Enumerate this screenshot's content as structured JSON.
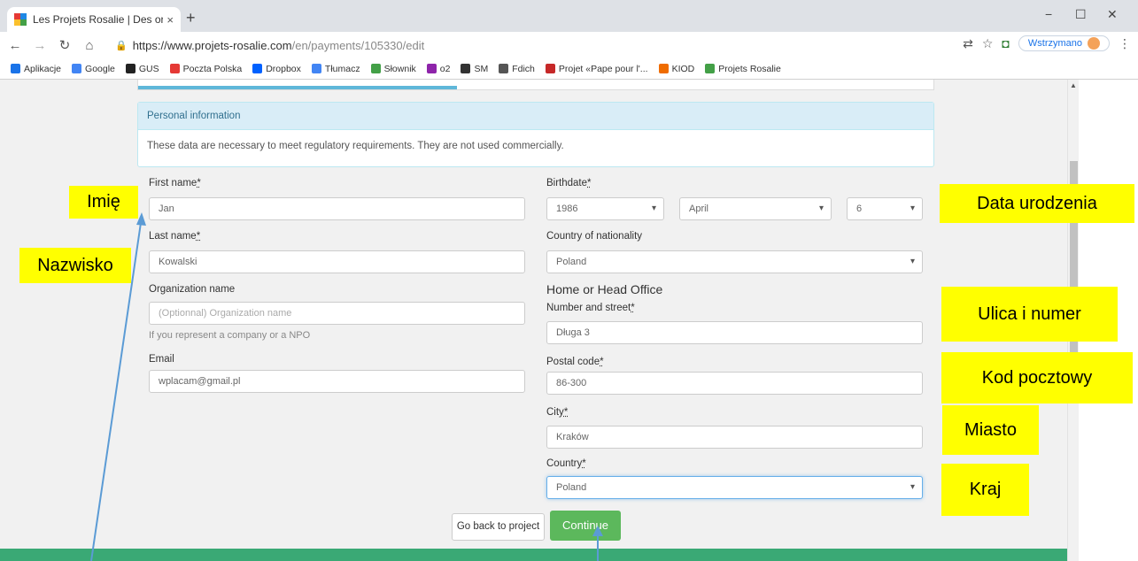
{
  "browser": {
    "tab_title": "Les Projets Rosalie | Des ordinate",
    "tab_close": "×",
    "new_tab": "+",
    "url_host": "https://www.projets-rosalie.com",
    "url_path": "/en/payments/105330/edit",
    "paused_label": "Wstrzymano",
    "window_controls": [
      "−",
      "☐",
      "✕"
    ],
    "bookmarks": [
      {
        "label": "Aplikacje",
        "color": "#1a73e8"
      },
      {
        "label": "Google",
        "color": "#4285f4"
      },
      {
        "label": "GUS",
        "color": "#222222"
      },
      {
        "label": "Poczta Polska",
        "color": "#e53935"
      },
      {
        "label": "Dropbox",
        "color": "#0061ff"
      },
      {
        "label": "Tłumacz",
        "color": "#4285f4"
      },
      {
        "label": "Słownik",
        "color": "#43a047"
      },
      {
        "label": "o2",
        "color": "#8e24aa"
      },
      {
        "label": "SM",
        "color": "#333333"
      },
      {
        "label": "Fdich",
        "color": "#555555"
      },
      {
        "label": "Projet «Pape pour l'...",
        "color": "#c62828"
      },
      {
        "label": "KIOD",
        "color": "#ef6c00"
      },
      {
        "label": "Projets Rosalie",
        "color": "#43a047"
      }
    ]
  },
  "panel": {
    "heading": "Personal information",
    "body": "These data are necessary to meet regulatory requirements. They are not used commercially."
  },
  "form": {
    "first_name": {
      "label": "First name",
      "required": "*",
      "value": "Jan"
    },
    "last_name": {
      "label": "Last name",
      "required": "*",
      "value": "Kowalski"
    },
    "organization": {
      "label": "Organization name",
      "placeholder": "(Optionnal) Organization name",
      "help": "If you represent a company or a NPO"
    },
    "email": {
      "label": "Email",
      "value": "wplacam@gmail.pl"
    },
    "birthdate": {
      "label": "Birthdate",
      "required": "*",
      "year": "1986",
      "month": "April",
      "day": "6"
    },
    "nationality": {
      "label": "Country of nationality",
      "value": "Poland"
    },
    "office_title": "Home or Head Office",
    "street": {
      "label": "Number and street",
      "required": "*",
      "value": "Długa 3"
    },
    "postal": {
      "label": "Postal code",
      "required": "*",
      "value": "86-300"
    },
    "city": {
      "label": "City",
      "required": "*",
      "value": "Kraków"
    },
    "country": {
      "label": "Country",
      "required": "*",
      "value": "Poland"
    }
  },
  "buttons": {
    "back": "Go back to project",
    "continue": "Continue"
  },
  "annotations": {
    "imie": "Imię",
    "nazwisko": "Nazwisko",
    "data_urodzenia": "Data urodzenia",
    "ulica": "Ulica i numer",
    "kod": "Kod pocztowy",
    "miasto": "Miasto",
    "kraj": "Kraj"
  }
}
